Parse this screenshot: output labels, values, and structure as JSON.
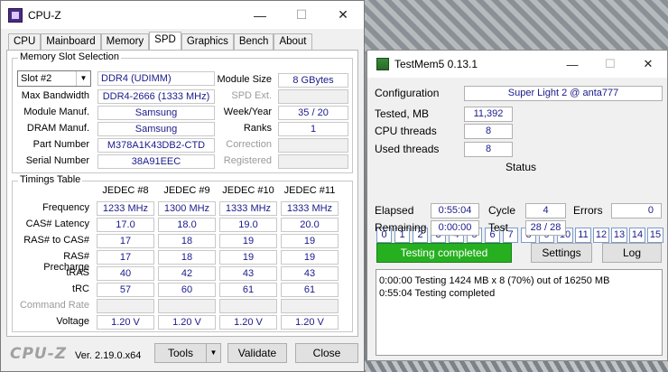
{
  "cpuz": {
    "title": "CPU-Z",
    "win": {
      "minimize": "—",
      "maximize": "☐",
      "close": "✕"
    },
    "tabs": [
      "CPU",
      "Mainboard",
      "Memory",
      "SPD",
      "Graphics",
      "Bench",
      "About"
    ],
    "slot_group": "Memory Slot Selection",
    "slot_select": "Slot #2",
    "slot_type": "DDR4 (UDIMM)",
    "labels": {
      "max_bw": "Max Bandwidth",
      "module_manuf": "Module Manuf.",
      "dram_manuf": "DRAM Manuf.",
      "part": "Part Number",
      "serial": "Serial Number",
      "module_size": "Module Size",
      "spd_ext": "SPD Ext.",
      "week_year": "Week/Year",
      "ranks": "Ranks",
      "correction": "Correction",
      "registered": "Registered"
    },
    "values": {
      "max_bw": "DDR4-2666 (1333 MHz)",
      "module_manuf": "Samsung",
      "dram_manuf": "Samsung",
      "part": "M378A1K43DB2-CTD",
      "serial": "38A91EEC",
      "module_size": "8 GBytes",
      "spd_ext": "",
      "week_year": "35 / 20",
      "ranks": "1",
      "correction": "",
      "registered": ""
    },
    "timings_group": "Timings Table",
    "timing_headers": [
      "JEDEC #8",
      "JEDEC #9",
      "JEDEC #10",
      "JEDEC #11"
    ],
    "timing_rows": [
      {
        "label": "Frequency",
        "values": [
          "1233 MHz",
          "1300 MHz",
          "1333 MHz",
          "1333 MHz"
        ],
        "dim": false
      },
      {
        "label": "CAS# Latency",
        "values": [
          "17.0",
          "18.0",
          "19.0",
          "20.0"
        ],
        "dim": false
      },
      {
        "label": "RAS# to CAS#",
        "values": [
          "17",
          "18",
          "19",
          "19"
        ],
        "dim": false
      },
      {
        "label": "RAS# Precharge",
        "values": [
          "17",
          "18",
          "19",
          "19"
        ],
        "dim": false
      },
      {
        "label": "tRAS",
        "values": [
          "40",
          "42",
          "43",
          "43"
        ],
        "dim": false
      },
      {
        "label": "tRC",
        "values": [
          "57",
          "60",
          "61",
          "61"
        ],
        "dim": false
      },
      {
        "label": "Command Rate",
        "values": [
          "",
          "",
          "",
          ""
        ],
        "dim": true
      },
      {
        "label": "Voltage",
        "values": [
          "1.20 V",
          "1.20 V",
          "1.20 V",
          "1.20 V"
        ],
        "dim": false
      }
    ],
    "logo": "CPU-Z",
    "version": "Ver. 2.19.0.x64",
    "btn_tools": "Tools",
    "btn_validate": "Validate",
    "btn_close": "Close"
  },
  "testmem": {
    "title": "TestMem5  0.13.1",
    "win": {
      "minimize": "—",
      "maximize": "☐",
      "close": "✕"
    },
    "config_label": "Configuration",
    "config_value": "Super Light 2 @ anta777",
    "tested_label": "Tested, MB",
    "tested_value": "11,392",
    "cpu_threads_label": "CPU threads",
    "cpu_threads_value": "8",
    "used_threads_label": "Used threads",
    "used_threads_value": "8",
    "status_label": "Status",
    "status_boxes": [
      "0",
      "1",
      "2",
      "3",
      "4",
      "5",
      "6",
      "7",
      "8",
      "9",
      "10",
      "11",
      "12",
      "13",
      "14",
      "15"
    ],
    "elapsed_label": "Elapsed",
    "elapsed_value": "0:55:04",
    "cycle_label": "Cycle",
    "cycle_value": "4",
    "errors_label": "Errors",
    "errors_value": "0",
    "remaining_label": "Remaining",
    "remaining_value": "0:00:00",
    "test_label": "Test",
    "test_value": "28 / 28",
    "status_text": "Testing completed",
    "btn_settings": "Settings",
    "btn_log": "Log",
    "log_lines": [
      "0:00:00  Testing 1424 MB x 8 (70%) out of 16250 MB",
      "0:55:04  Testing completed"
    ]
  }
}
